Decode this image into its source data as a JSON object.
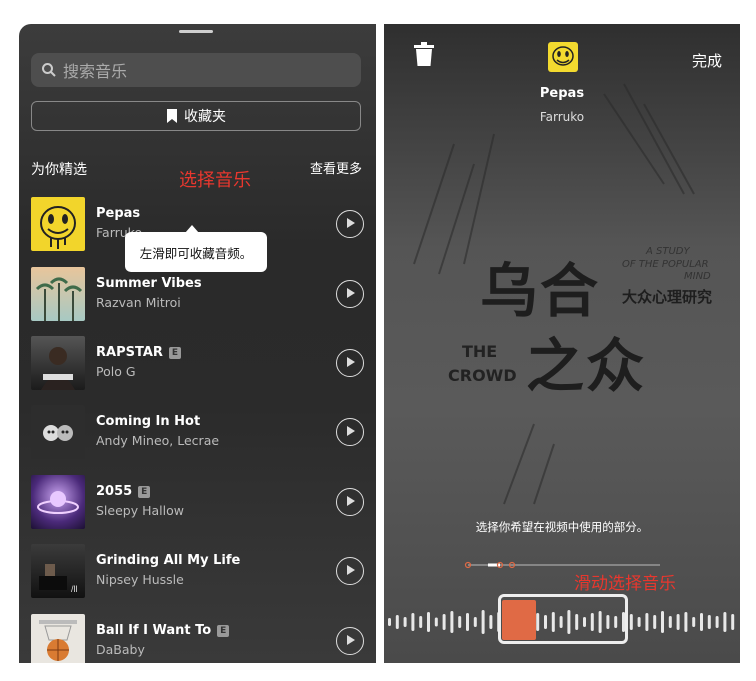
{
  "left_panel": {
    "search_placeholder": "搜索音乐",
    "favorites_label": "收藏夹",
    "section_title": "为你精选",
    "see_more": "查看更多",
    "annotation": "选择音乐",
    "tooltip": "左滑即可收藏音频。",
    "tracks": [
      {
        "title": "Pepas",
        "artist": "Farruko",
        "explicit": false,
        "art": "smiley-yellow"
      },
      {
        "title": "Summer Vibes",
        "artist": "Razvan Mitroi",
        "explicit": false,
        "art": "palm-trees"
      },
      {
        "title": "RAPSTAR",
        "artist": "Polo G",
        "explicit": true,
        "art": "portrait-dark"
      },
      {
        "title": "Coming In Hot",
        "artist": "Andy Mineo, Lecrae",
        "explicit": false,
        "art": "faces-bw"
      },
      {
        "title": "2055",
        "artist": "Sleepy Hallow",
        "explicit": true,
        "art": "purple-space"
      },
      {
        "title": "Grinding All My Life",
        "artist": "Nipsey Hussle",
        "explicit": false,
        "art": "piano-room"
      },
      {
        "title": "Ball If I Want To",
        "artist": "DaBaby",
        "explicit": true,
        "art": "basketball-hoop"
      }
    ],
    "explicit_badge": "E"
  },
  "right_panel": {
    "done_label": "完成",
    "song_title": "Pepas",
    "song_artist": "Farruko",
    "book": {
      "cn_title_1": "乌合",
      "cn_title_2": "之众",
      "en_title_1": "THE",
      "en_title_2": "CROWD",
      "subtitle_en_1": "A STUDY",
      "subtitle_en_2": "OF THE POPULAR",
      "subtitle_en_3": "MIND",
      "subtitle_cn": "大众心理研究"
    },
    "hint": "选择你希望在视频中使用的部分。",
    "annotation": "滑动选择音乐"
  },
  "colors": {
    "accent_red": "#e8372e",
    "waveform_selected": "#e06a45"
  }
}
